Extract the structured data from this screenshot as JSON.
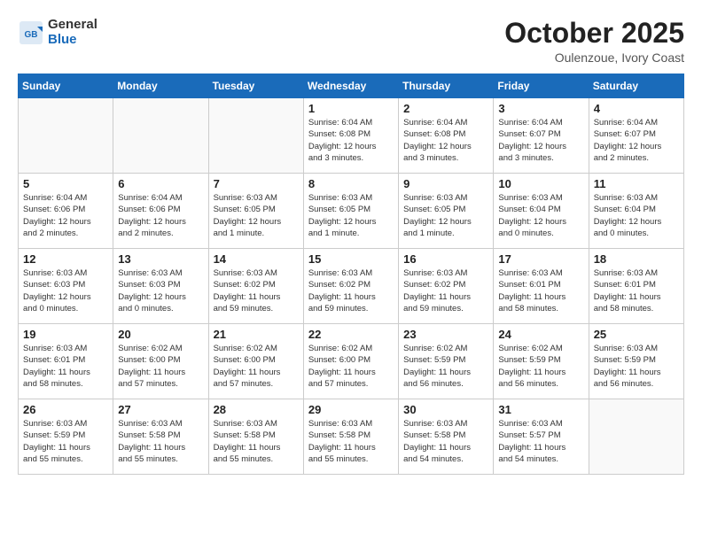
{
  "header": {
    "logo_general": "General",
    "logo_blue": "Blue",
    "title": "October 2025",
    "subtitle": "Oulenzoue, Ivory Coast"
  },
  "weekdays": [
    "Sunday",
    "Monday",
    "Tuesday",
    "Wednesday",
    "Thursday",
    "Friday",
    "Saturday"
  ],
  "weeks": [
    [
      {
        "day": "",
        "info": ""
      },
      {
        "day": "",
        "info": ""
      },
      {
        "day": "",
        "info": ""
      },
      {
        "day": "1",
        "info": "Sunrise: 6:04 AM\nSunset: 6:08 PM\nDaylight: 12 hours\nand 3 minutes."
      },
      {
        "day": "2",
        "info": "Sunrise: 6:04 AM\nSunset: 6:08 PM\nDaylight: 12 hours\nand 3 minutes."
      },
      {
        "day": "3",
        "info": "Sunrise: 6:04 AM\nSunset: 6:07 PM\nDaylight: 12 hours\nand 3 minutes."
      },
      {
        "day": "4",
        "info": "Sunrise: 6:04 AM\nSunset: 6:07 PM\nDaylight: 12 hours\nand 2 minutes."
      }
    ],
    [
      {
        "day": "5",
        "info": "Sunrise: 6:04 AM\nSunset: 6:06 PM\nDaylight: 12 hours\nand 2 minutes."
      },
      {
        "day": "6",
        "info": "Sunrise: 6:04 AM\nSunset: 6:06 PM\nDaylight: 12 hours\nand 2 minutes."
      },
      {
        "day": "7",
        "info": "Sunrise: 6:03 AM\nSunset: 6:05 PM\nDaylight: 12 hours\nand 1 minute."
      },
      {
        "day": "8",
        "info": "Sunrise: 6:03 AM\nSunset: 6:05 PM\nDaylight: 12 hours\nand 1 minute."
      },
      {
        "day": "9",
        "info": "Sunrise: 6:03 AM\nSunset: 6:05 PM\nDaylight: 12 hours\nand 1 minute."
      },
      {
        "day": "10",
        "info": "Sunrise: 6:03 AM\nSunset: 6:04 PM\nDaylight: 12 hours\nand 0 minutes."
      },
      {
        "day": "11",
        "info": "Sunrise: 6:03 AM\nSunset: 6:04 PM\nDaylight: 12 hours\nand 0 minutes."
      }
    ],
    [
      {
        "day": "12",
        "info": "Sunrise: 6:03 AM\nSunset: 6:03 PM\nDaylight: 12 hours\nand 0 minutes."
      },
      {
        "day": "13",
        "info": "Sunrise: 6:03 AM\nSunset: 6:03 PM\nDaylight: 12 hours\nand 0 minutes."
      },
      {
        "day": "14",
        "info": "Sunrise: 6:03 AM\nSunset: 6:02 PM\nDaylight: 11 hours\nand 59 minutes."
      },
      {
        "day": "15",
        "info": "Sunrise: 6:03 AM\nSunset: 6:02 PM\nDaylight: 11 hours\nand 59 minutes."
      },
      {
        "day": "16",
        "info": "Sunrise: 6:03 AM\nSunset: 6:02 PM\nDaylight: 11 hours\nand 59 minutes."
      },
      {
        "day": "17",
        "info": "Sunrise: 6:03 AM\nSunset: 6:01 PM\nDaylight: 11 hours\nand 58 minutes."
      },
      {
        "day": "18",
        "info": "Sunrise: 6:03 AM\nSunset: 6:01 PM\nDaylight: 11 hours\nand 58 minutes."
      }
    ],
    [
      {
        "day": "19",
        "info": "Sunrise: 6:03 AM\nSunset: 6:01 PM\nDaylight: 11 hours\nand 58 minutes."
      },
      {
        "day": "20",
        "info": "Sunrise: 6:02 AM\nSunset: 6:00 PM\nDaylight: 11 hours\nand 57 minutes."
      },
      {
        "day": "21",
        "info": "Sunrise: 6:02 AM\nSunset: 6:00 PM\nDaylight: 11 hours\nand 57 minutes."
      },
      {
        "day": "22",
        "info": "Sunrise: 6:02 AM\nSunset: 6:00 PM\nDaylight: 11 hours\nand 57 minutes."
      },
      {
        "day": "23",
        "info": "Sunrise: 6:02 AM\nSunset: 5:59 PM\nDaylight: 11 hours\nand 56 minutes."
      },
      {
        "day": "24",
        "info": "Sunrise: 6:02 AM\nSunset: 5:59 PM\nDaylight: 11 hours\nand 56 minutes."
      },
      {
        "day": "25",
        "info": "Sunrise: 6:03 AM\nSunset: 5:59 PM\nDaylight: 11 hours\nand 56 minutes."
      }
    ],
    [
      {
        "day": "26",
        "info": "Sunrise: 6:03 AM\nSunset: 5:59 PM\nDaylight: 11 hours\nand 55 minutes."
      },
      {
        "day": "27",
        "info": "Sunrise: 6:03 AM\nSunset: 5:58 PM\nDaylight: 11 hours\nand 55 minutes."
      },
      {
        "day": "28",
        "info": "Sunrise: 6:03 AM\nSunset: 5:58 PM\nDaylight: 11 hours\nand 55 minutes."
      },
      {
        "day": "29",
        "info": "Sunrise: 6:03 AM\nSunset: 5:58 PM\nDaylight: 11 hours\nand 55 minutes."
      },
      {
        "day": "30",
        "info": "Sunrise: 6:03 AM\nSunset: 5:58 PM\nDaylight: 11 hours\nand 54 minutes."
      },
      {
        "day": "31",
        "info": "Sunrise: 6:03 AM\nSunset: 5:57 PM\nDaylight: 11 hours\nand 54 minutes."
      },
      {
        "day": "",
        "info": ""
      }
    ]
  ]
}
